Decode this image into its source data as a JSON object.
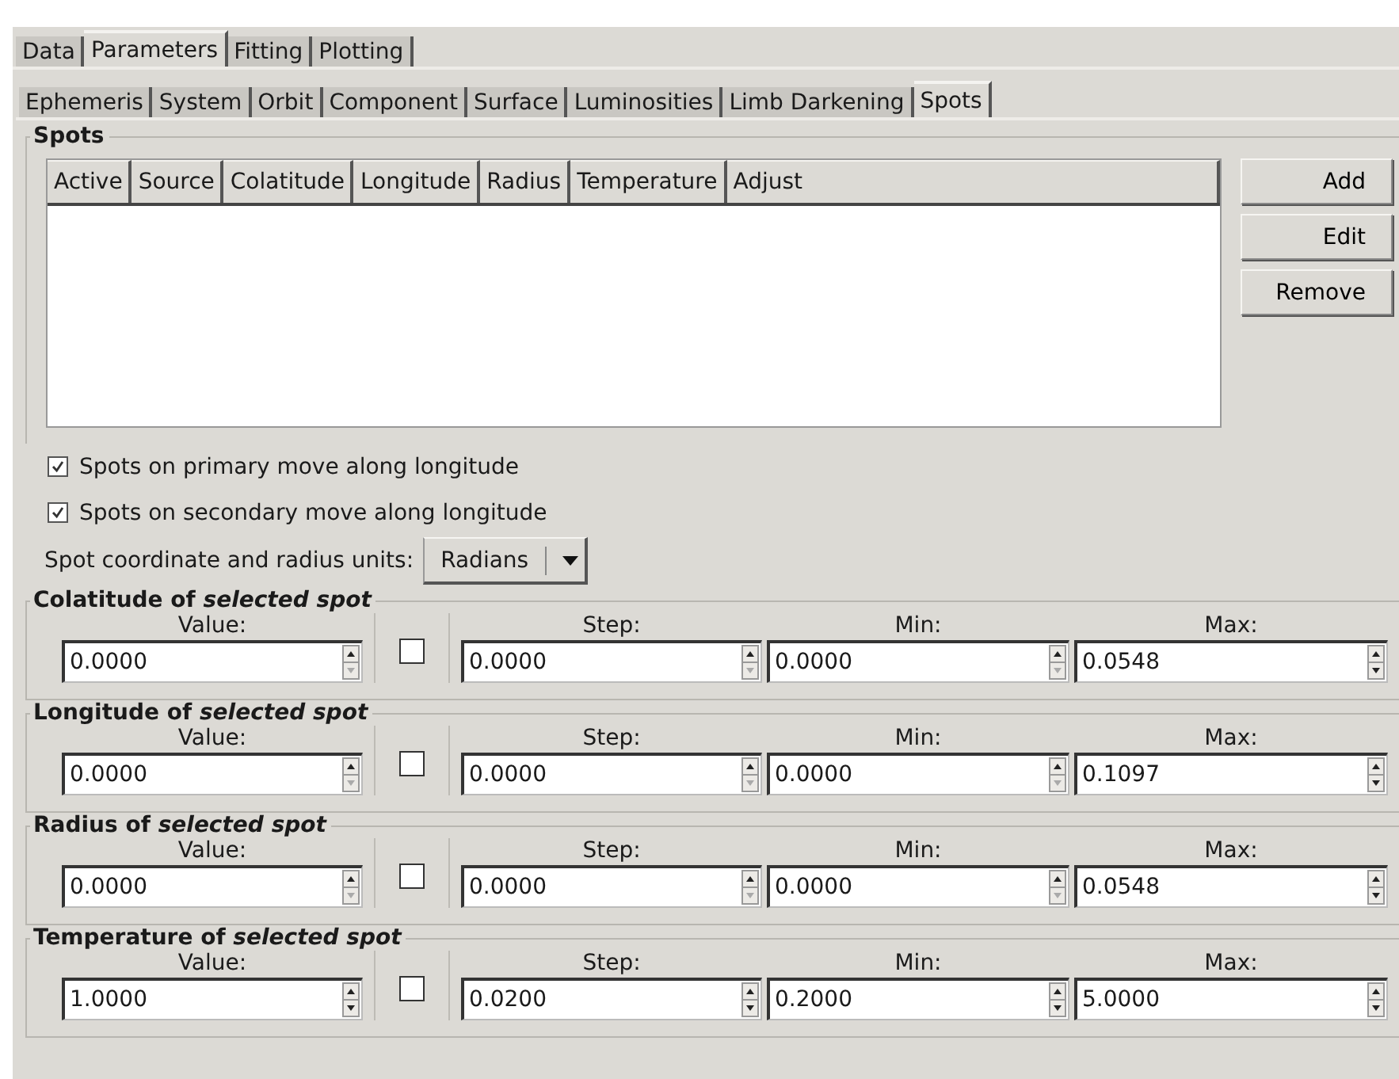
{
  "main_tabs": [
    {
      "label": "Data",
      "selected": false
    },
    {
      "label": "Parameters",
      "selected": true
    },
    {
      "label": "Fitting",
      "selected": false
    },
    {
      "label": "Plotting",
      "selected": false
    }
  ],
  "sub_tabs": [
    {
      "label": "Ephemeris",
      "selected": false
    },
    {
      "label": "System",
      "selected": false
    },
    {
      "label": "Orbit",
      "selected": false
    },
    {
      "label": "Component",
      "selected": false
    },
    {
      "label": "Surface",
      "selected": false
    },
    {
      "label": "Luminosities",
      "selected": false
    },
    {
      "label": "Limb Darkening",
      "selected": false
    },
    {
      "label": "Spots",
      "selected": true
    }
  ],
  "spots_group": {
    "title": "Spots",
    "table": {
      "columns": [
        "Active",
        "Source",
        "Colatitude",
        "Longitude",
        "Radius",
        "Temperature",
        "Adjust"
      ]
    },
    "buttons": [
      "Add",
      "Edit",
      "Remove"
    ]
  },
  "options": [
    {
      "label": "Spots on primary move along longitude",
      "checked": true
    },
    {
      "label": "Spots on secondary move along longitude",
      "checked": true
    }
  ],
  "units": {
    "label": "Spot coordinate and radius units:",
    "value": "Radians"
  },
  "parameters": [
    {
      "title": "Colatitude of *selected spot*",
      "adjust": false,
      "value_label": "Value:",
      "step_label": "Step:",
      "min_label": "Min:",
      "max_label": "Max:",
      "value": {
        "text": "0.0000",
        "at_min": true
      },
      "step": {
        "text": "0.0000",
        "at_min": true
      },
      "min": {
        "text": "0.0000",
        "at_min": true
      },
      "max": {
        "text": "0.0548",
        "at_min": false
      }
    },
    {
      "title": "Longitude of *selected spot*",
      "adjust": false,
      "value_label": "Value:",
      "step_label": "Step:",
      "min_label": "Min:",
      "max_label": "Max:",
      "value": {
        "text": "0.0000",
        "at_min": true
      },
      "step": {
        "text": "0.0000",
        "at_min": true
      },
      "min": {
        "text": "0.0000",
        "at_min": true
      },
      "max": {
        "text": "0.1097",
        "at_min": false
      }
    },
    {
      "title": "Radius of *selected spot*",
      "adjust": false,
      "value_label": "Value:",
      "step_label": "Step:",
      "min_label": "Min:",
      "max_label": "Max:",
      "value": {
        "text": "0.0000",
        "at_min": true
      },
      "step": {
        "text": "0.0000",
        "at_min": true
      },
      "min": {
        "text": "0.0000",
        "at_min": true
      },
      "max": {
        "text": "0.0548",
        "at_min": false
      }
    },
    {
      "title": "Temperature of *selected spot*",
      "adjust": false,
      "value_label": "Value:",
      "step_label": "Step:",
      "min_label": "Min:",
      "max_label": "Max:",
      "value": {
        "text": "1.0000",
        "at_min": false
      },
      "step": {
        "text": "0.0200",
        "at_min": false
      },
      "min": {
        "text": "0.2000",
        "at_min": false
      },
      "max": {
        "text": "5.0000",
        "at_min": false
      }
    }
  ]
}
